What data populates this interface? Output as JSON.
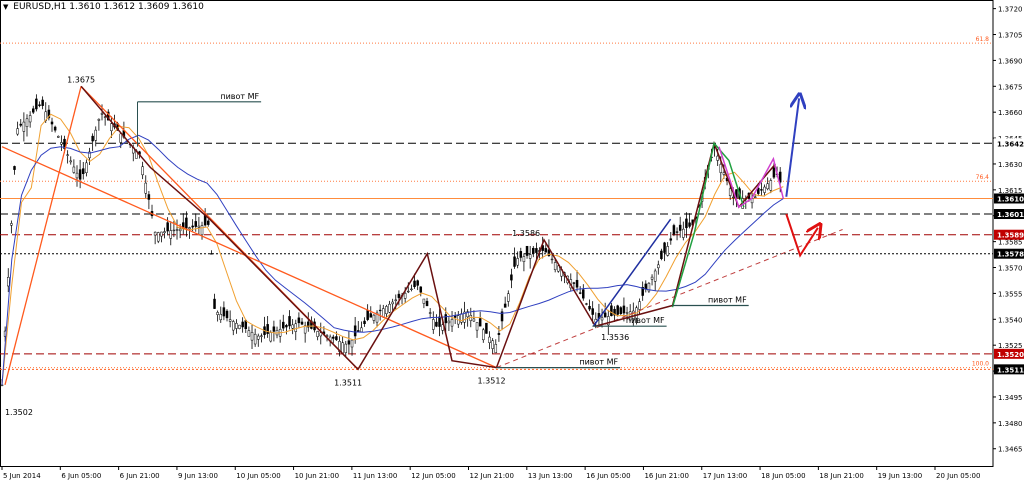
{
  "header": {
    "symbol_label": "EURUSD,H1",
    "ohlc_label": "1.3610 1.3612 1.3609 1.3610"
  },
  "chart_data": {
    "type": "candlestick",
    "symbol": "EURUSD",
    "timeframe": "H1",
    "ohlc": {
      "open": 1.361,
      "high": 1.3612,
      "low": 1.3609,
      "close": 1.361
    },
    "ylim": [
      1.3455,
      1.3725
    ],
    "price_ticks": [
      "1.3720",
      "1.3705",
      "1.3690",
      "1.3675",
      "1.3660",
      "1.3645",
      "1.3630",
      "1.3615",
      "1.3600",
      "1.3585",
      "1.3570",
      "1.3555",
      "1.3540",
      "1.3525",
      "1.3510",
      "1.3495",
      "1.3480",
      "1.3465"
    ],
    "time_labels": [
      "5 Jun 2014",
      "6 Jun 05:00",
      "6 Jun 21:00",
      "9 Jun 13:00",
      "10 Jun 05:00",
      "10 Jun 21:00",
      "11 Jun 13:00",
      "12 Jun 05:00",
      "12 Jun 21:00",
      "13 Jun 13:00",
      "16 Jun 05:00",
      "16 Jun 21:00",
      "17 Jun 13:00",
      "18 Jun 05:00",
      "18 Jun 21:00",
      "19 Jun 13:00",
      "20 Jun 05:00"
    ],
    "levels": [
      {
        "price": 1.3642,
        "label": "1.3642",
        "style": "dashed",
        "color": "#000000",
        "label_bg": "#ffffff",
        "label_color": "#000000"
      },
      {
        "price": 1.361,
        "label": "1.3610",
        "style": "solid",
        "color": "#ff8c3c",
        "label_bg": "#000000",
        "label_color": "#ffffff"
      },
      {
        "price": 1.3601,
        "label": "1.3601",
        "style": "dashed",
        "color": "#000000",
        "label_bg": "#000000",
        "label_color": "#ffffff"
      },
      {
        "price": 1.3589,
        "label": "1.3589",
        "style": "dashed",
        "color": "#a00000",
        "label_bg": "#c00000",
        "label_color": "#ffffff"
      },
      {
        "price": 1.3578,
        "label": "1.3578",
        "style": "dotted",
        "color": "#000000",
        "label_bg": "#000000",
        "label_color": "#ffffff"
      },
      {
        "price": 1.352,
        "label": "1.3520",
        "style": "dashed",
        "color": "#a00000",
        "label_bg": "#c00000",
        "label_color": "#ffffff"
      },
      {
        "price": 1.3511,
        "label": "1.3511",
        "style": "dotted",
        "color": "#ff6020",
        "label_bg": "#000000",
        "label_color": "#ffffff"
      }
    ],
    "fib_levels": [
      {
        "price": 1.37,
        "label": "61.8"
      },
      {
        "price": 1.362,
        "label": "76.4"
      },
      {
        "price": 1.3512,
        "label": "100.0"
      }
    ],
    "price_annotations": [
      {
        "text": "1.3675",
        "price": 1.3675,
        "t": 0.08
      },
      {
        "text": "1.3586",
        "price": 1.3586,
        "t": 0.53
      },
      {
        "text": "1.3536",
        "price": 1.3536,
        "t": 0.62
      },
      {
        "text": "1.3511",
        "price": 1.3511,
        "t": 0.35
      },
      {
        "text": "1.3512",
        "price": 1.3512,
        "t": 0.495
      },
      {
        "text": "1.3502",
        "price": 1.3502,
        "t": 0.003
      }
    ],
    "pivot_label": "пивот MF",
    "pivots": [
      {
        "price": 1.3666,
        "t0": 0.137,
        "t1": 0.262
      },
      {
        "price": 1.3548,
        "t0": 0.678,
        "t1": 0.755
      },
      {
        "price": 1.3536,
        "t0": 0.597,
        "t1": 0.672
      },
      {
        "price": 1.3512,
        "t0": 0.5,
        "t1": 0.625
      }
    ],
    "zigzag_dark": [
      [
        0.08,
        1.3675
      ],
      [
        0.15,
        1.3628
      ],
      [
        0.21,
        1.3598
      ],
      [
        0.36,
        1.3511
      ],
      [
        0.43,
        1.3578
      ],
      [
        0.455,
        1.3516
      ],
      [
        0.5,
        1.3512
      ],
      [
        0.548,
        1.3586
      ],
      [
        0.6,
        1.3536
      ],
      [
        0.678,
        1.3548
      ],
      [
        0.72,
        1.3642
      ],
      [
        0.745,
        1.3605
      ],
      [
        0.782,
        1.363
      ]
    ],
    "zigzag_blue": [
      [
        0.598,
        1.3536
      ],
      [
        0.676,
        1.3598
      ]
    ],
    "zigzag_green": [
      [
        0.678,
        1.3547
      ],
      [
        0.7,
        1.359
      ],
      [
        0.72,
        1.3642
      ],
      [
        0.735,
        1.3632
      ],
      [
        0.75,
        1.3605
      ]
    ],
    "zigzag_magenta": [
      [
        0.725,
        1.364
      ],
      [
        0.745,
        1.3605
      ],
      [
        0.758,
        1.361
      ],
      [
        0.78,
        1.3633
      ],
      [
        0.79,
        1.361
      ]
    ],
    "trendlines": [
      {
        "from": [
          0.003,
          1.3502
        ],
        "to": [
          0.08,
          1.3675
        ],
        "color": "#ff5a1e"
      },
      {
        "from": [
          0.0,
          1.364
        ],
        "to": [
          0.5,
          1.3512
        ],
        "color": "#ff5a1e"
      },
      {
        "from": [
          0.08,
          1.3675
        ],
        "to": [
          0.36,
          1.3511
        ],
        "color": "#ff5a1e"
      },
      {
        "from": [
          0.5,
          1.3512
        ],
        "to": [
          0.85,
          1.3592
        ],
        "color": "#c04040",
        "style": "dashed"
      }
    ],
    "forecast_blue": [
      [
        0.793,
        1.3611
      ],
      [
        0.806,
        1.3668
      ]
    ],
    "forecast_red": [
      [
        0.793,
        1.3601
      ],
      [
        0.807,
        1.3577
      ],
      [
        0.825,
        1.3593
      ]
    ]
  }
}
